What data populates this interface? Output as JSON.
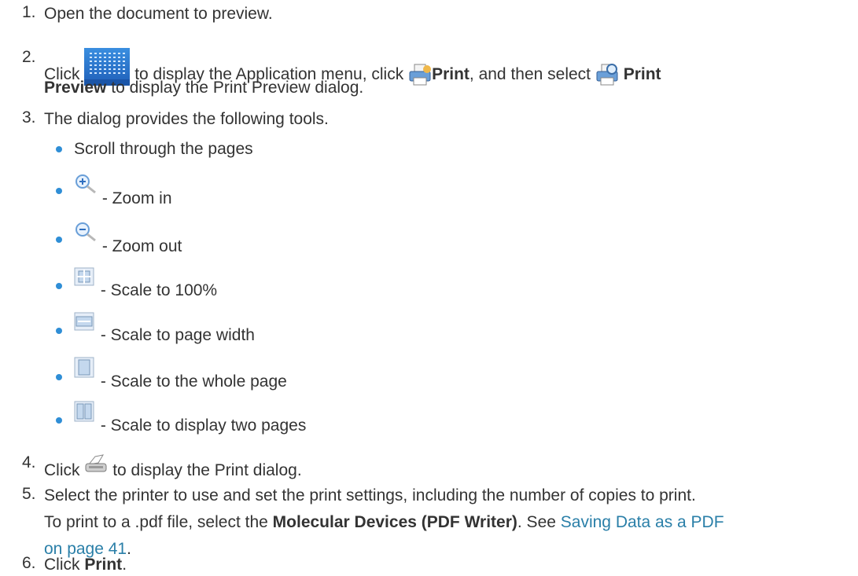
{
  "steps": [
    {
      "num": "1.",
      "text": "Open the document to preview."
    },
    {
      "num": "2.",
      "t1": "Click",
      "t2": "to display the Application menu, click",
      "print_label": "Print",
      "t3": ", and then select",
      "print_preview_a": "Print",
      "print_preview_b": "Preview",
      "t4": "to display the Print Preview dialog."
    },
    {
      "num": "3.",
      "text": "The dialog provides the following tools."
    },
    {
      "num": "4.",
      "t1": "Click",
      "t2": "to display the Print dialog."
    },
    {
      "num": "5.",
      "line1": "Select the printer to use and set the print settings, including the number of copies to print.",
      "t1": "To print to a .pdf file, select the",
      "bold": "Molecular Devices (PDF Writer)",
      "t2": ". See",
      "link_a": "Saving Data as a PDF",
      "link_b": "on page 41",
      "t3": "."
    },
    {
      "num": "6.",
      "t1": "Click",
      "bold": "Print",
      "t2": "."
    }
  ],
  "tools": [
    {
      "icon": "scroll-placeholder",
      "text": "Scroll through the pages"
    },
    {
      "icon": "zoom-in-icon",
      "text": "- Zoom in"
    },
    {
      "icon": "zoom-out-icon",
      "text": "- Zoom out"
    },
    {
      "icon": "scale-100-icon",
      "text": "- Scale to 100%"
    },
    {
      "icon": "scale-page-width-icon",
      "text": "- Scale to page width"
    },
    {
      "icon": "scale-whole-page-icon",
      "text": "- Scale to the whole page"
    },
    {
      "icon": "scale-two-pages-icon",
      "text": "- Scale to display two pages"
    }
  ],
  "colors": {
    "text": "#333333",
    "link": "#2a7fa8",
    "bullet": "#2f8ed6"
  }
}
